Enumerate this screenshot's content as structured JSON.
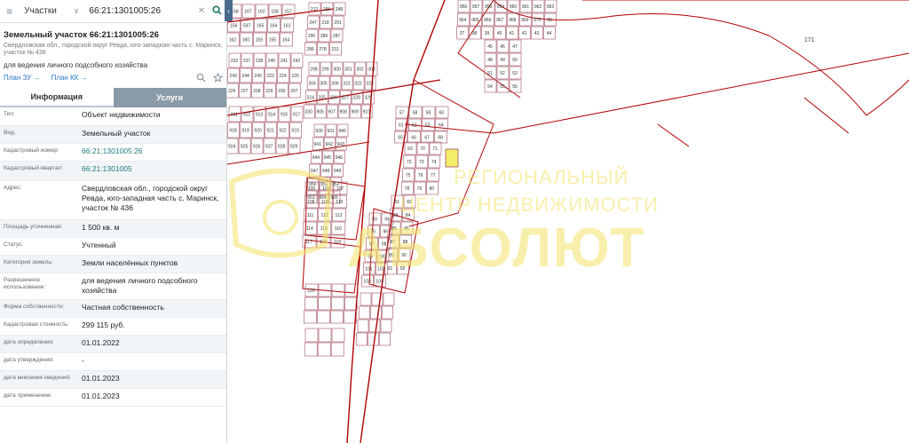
{
  "search": {
    "layer": "Участки",
    "query": "66:21:1301005:26"
  },
  "parcel": {
    "title": "Земельный участок 66:21:1301005:26",
    "address_line1": "Свердловская обл., городской округ Ревда, юго-западная часть с. Маринск,",
    "address_line2": "участок № 436",
    "purpose": "для ведения личного подсобного хозяйства"
  },
  "links": {
    "plan_zu": "План ЗУ →",
    "plan_kk": "План КК →"
  },
  "tabs": {
    "info": "Информация",
    "services": "Услуги"
  },
  "rows": {
    "type": {
      "k": "Тип:",
      "v": "Объект недвижимости"
    },
    "kind": {
      "k": "Вид:",
      "v": "Земельный участок"
    },
    "cadnum": {
      "k": "Кадастровый номер:",
      "v": "66:21:1301005:26"
    },
    "quarter": {
      "k": "Кадастровый квартал:",
      "v": "66:21:1301005"
    },
    "address": {
      "k": "Адрес:",
      "v": "Свердловская обл., городской округ Ревда, юго-западная часть с. Маринск, участок № 436"
    },
    "area": {
      "k": "Площадь уточненная:",
      "v": "1 500 кв. м"
    },
    "status": {
      "k": "Статус:",
      "v": "Учтенный"
    },
    "category": {
      "k": "Категория земель:",
      "v": "Земли населённых пунктов"
    },
    "usage": {
      "k": "Разрешенное использование:",
      "v": "для ведения личного подсобного хозяйства"
    },
    "ownership": {
      "k": "Форма собственности:",
      "v": "Частная собственность"
    },
    "cost": {
      "k": "Кадастровая стоимость:",
      "v": "299 115 руб."
    },
    "date_def": {
      "k": "дата определения:",
      "v": "01.01.2022"
    },
    "date_appr": {
      "k": "дата утверждения:",
      "v": "-"
    },
    "date_info": {
      "k": "дата внесения сведений:",
      "v": "01.01.2023"
    },
    "date_apply": {
      "k": "дата применения:",
      "v": "01.01.2023"
    }
  },
  "map": {
    "label_171": "171",
    "watermark_line1": "РЕГИОНАЛЬНЫЙ",
    "watermark_line2": "ЦЕНТР НЕДВИЖИМОСТИ",
    "watermark_big": "АБСОЛЮТ",
    "parcel_numbers": [
      "168",
      "167",
      "162",
      "158",
      "157",
      "156",
      "597",
      "165",
      "164",
      "163",
      "162",
      "160",
      "159",
      "155",
      "154",
      "212",
      "195",
      "248",
      "247",
      "218",
      "291",
      "290",
      "289",
      "287",
      "286",
      "278",
      "231",
      "232",
      "237",
      "238",
      "240",
      "241",
      "242",
      "243",
      "244",
      "245",
      "223",
      "224",
      "225",
      "226",
      "227",
      "228",
      "229",
      "230",
      "297",
      "298",
      "299",
      "300",
      "301",
      "302",
      "303",
      "304",
      "305",
      "306",
      "321",
      "322",
      "323",
      "324",
      "325",
      "326",
      "327",
      "328",
      "329",
      "330",
      "905",
      "907",
      "908",
      "909",
      "910",
      "911",
      "912",
      "913",
      "914",
      "915",
      "917",
      "918",
      "919",
      "920",
      "921",
      "922",
      "923",
      "924",
      "925",
      "926",
      "927",
      "928",
      "929",
      "930",
      "931",
      "940",
      "941",
      "942",
      "943",
      "944",
      "945",
      "946",
      "947",
      "948",
      "949",
      "950",
      "951",
      "952",
      "953",
      "954",
      "955",
      "956",
      "957",
      "958",
      "959",
      "960",
      "961",
      "962",
      "963",
      "964",
      "965",
      "966",
      "967",
      "968",
      "969",
      "970",
      "36",
      "37",
      "38",
      "39",
      "40",
      "41",
      "42",
      "43",
      "44",
      "45",
      "46",
      "47",
      "48",
      "49",
      "50",
      "51",
      "52",
      "53",
      "54",
      "55",
      "56",
      "57",
      "58",
      "59",
      "60",
      "61",
      "62",
      "63",
      "64",
      "65",
      "66",
      "67",
      "68",
      "69",
      "70",
      "71",
      "72",
      "73",
      "74",
      "75",
      "76",
      "77",
      "78",
      "79",
      "80",
      "81",
      "82",
      "83",
      "84",
      "85",
      "86",
      "87",
      "88",
      "89",
      "90",
      "91",
      "92",
      "93",
      "94",
      "95",
      "96",
      "97",
      "98",
      "99",
      "100",
      "101",
      "102",
      "103",
      "104",
      "105",
      "106",
      "107",
      "108",
      "109",
      "110",
      "111",
      "112",
      "113",
      "114",
      "115",
      "116",
      "117",
      "118",
      "119",
      "120"
    ]
  },
  "colors": {
    "parcel_line": "#a05060",
    "boundary": "#b00000",
    "highlight": "#f3ee6a",
    "link": "#2a77c9",
    "tab_inactive": "#8b9aa7",
    "watermark": "#f3e36a"
  }
}
